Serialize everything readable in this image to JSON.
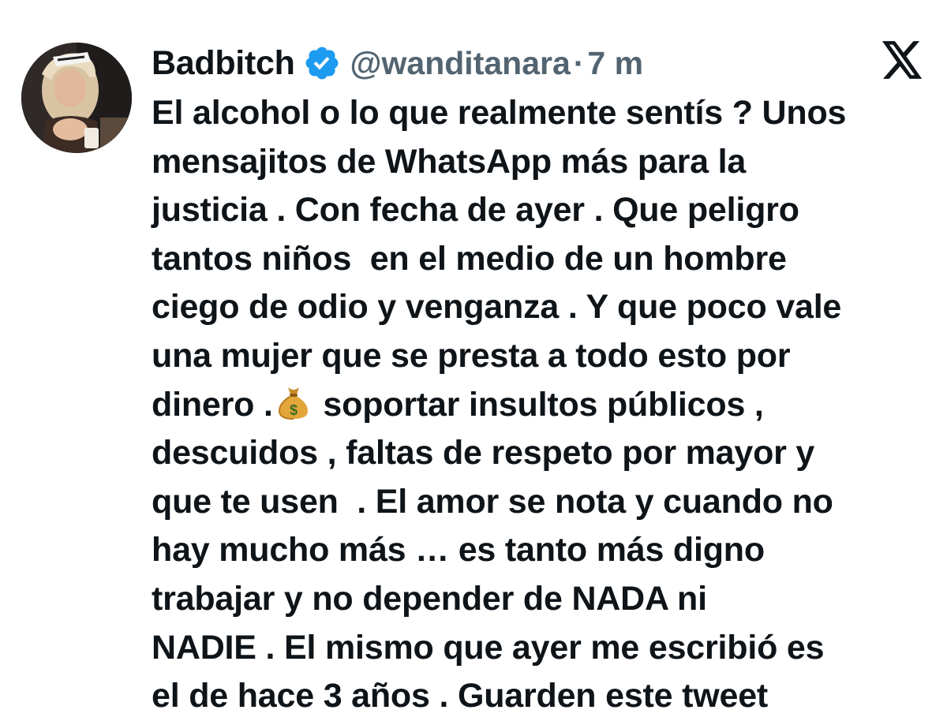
{
  "author": {
    "display_name": "Badbitch",
    "handle": "@wanditanara",
    "separator": "·",
    "time": "7 m",
    "avatar_icon": "profile-photo",
    "verified_icon": "verified-badge-icon",
    "verified_color": "#1d9bf0"
  },
  "platform": {
    "logo_icon": "x-logo-icon"
  },
  "tweet": {
    "lines": [
      "El alcohol o lo que realmente sentís ? Unos",
      "mensajitos de WhatsApp más para la",
      "justicia . Con fecha de ayer . Que peligro",
      "tantos niños  en el medio de un hombre",
      "ciego de odio y venganza . Y que poco vale",
      "una mujer que se presta a todo esto por",
      "dinero .",
      " soportar insultos públicos ,",
      "descuidos , faltas de respeto por mayor y",
      "que te usen  . El amor se nota y cuando no",
      "hay mucho más … es tanto más digno",
      "trabajar y no depender de NADA ni",
      "NADIE . El mismo que ayer me escribió es",
      "el de hace 3 años . Guarden este tweet"
    ],
    "emoji": "money-bag-icon"
  },
  "colors": {
    "text": "#0f1419",
    "secondary": "#536471",
    "background": "#ffffff"
  }
}
